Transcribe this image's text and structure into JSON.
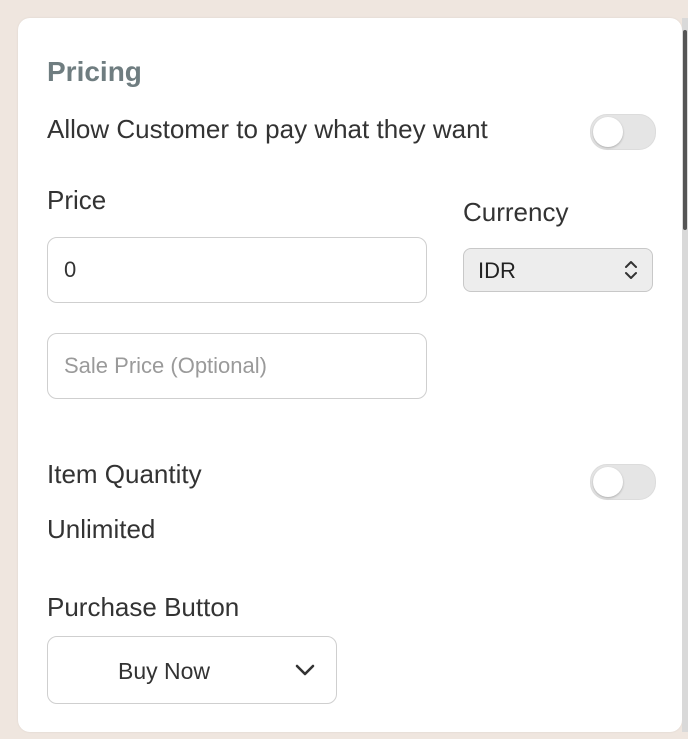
{
  "pricing": {
    "title": "Pricing",
    "allow_label": "Allow Customer to pay what they want",
    "allow_toggle_on": false,
    "price_label": "Price",
    "price_value": "0",
    "sale_price_placeholder": "Sale Price (Optional)",
    "currency_label": "Currency",
    "currency_value": "IDR",
    "item_quantity_label": "Item Quantity",
    "item_quantity_toggle_on": false,
    "item_quantity_status": "Unlimited",
    "purchase_button_label": "Purchase Button",
    "purchase_button_value": "Buy Now"
  },
  "icons": {
    "currency_chevron": "chevron-up-down-icon",
    "purchase_chevron": "chevron-down-icon"
  }
}
